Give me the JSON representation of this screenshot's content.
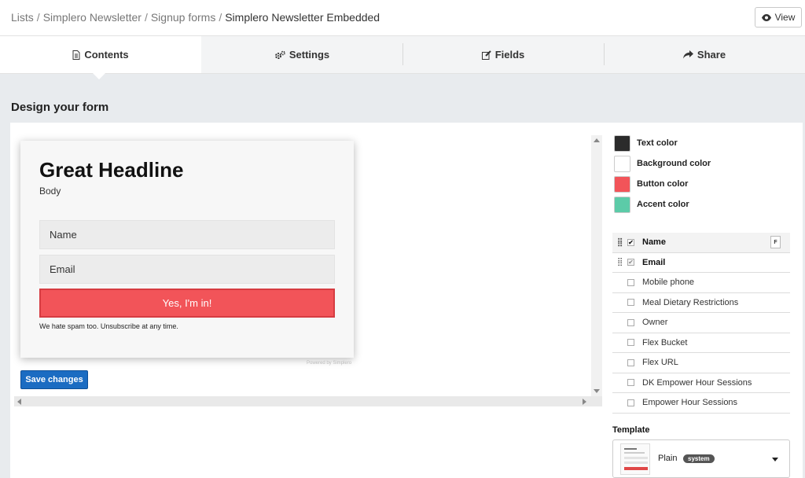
{
  "breadcrumb": {
    "items": [
      "Lists",
      "Simplero Newsletter",
      "Signup forms"
    ],
    "current": "Simplero Newsletter Embedded",
    "separator": "/"
  },
  "header": {
    "view_label": "View",
    "view_icon": "eye-icon"
  },
  "tabs": [
    {
      "label": "Contents",
      "icon": "document-icon",
      "active": true
    },
    {
      "label": "Settings",
      "icon": "gears-icon",
      "active": false
    },
    {
      "label": "Fields",
      "icon": "edit-icon",
      "active": false
    },
    {
      "label": "Share",
      "icon": "share-icon",
      "active": false
    }
  ],
  "section_title": "Design your form",
  "form_preview": {
    "headline": "Great Headline",
    "body": "Body",
    "name_placeholder": "Name",
    "email_placeholder": "Email",
    "button_label": "Yes, I'm in!",
    "disclaimer": "We hate spam too. Unsubscribe at any time.",
    "powered_by": "Powered by Simplero"
  },
  "save_label": "Save changes",
  "colors": [
    {
      "label": "Text color",
      "value": "#2b2b2b"
    },
    {
      "label": "Background color",
      "value": "#ffffff"
    },
    {
      "label": "Button color",
      "value": "#f25459"
    },
    {
      "label": "Accent color",
      "value": "#5ccba8"
    }
  ],
  "fields": [
    {
      "label": "Name",
      "checked": true,
      "locked": false,
      "draggable": true,
      "bold": true,
      "badge": "F"
    },
    {
      "label": "Email",
      "checked": true,
      "locked": true,
      "draggable": true,
      "bold": true
    },
    {
      "label": "Mobile phone",
      "checked": false
    },
    {
      "label": "Meal Dietary Restrictions",
      "checked": false
    },
    {
      "label": "Owner",
      "checked": false
    },
    {
      "label": "Flex Bucket",
      "checked": false
    },
    {
      "label": "Flex URL",
      "checked": false
    },
    {
      "label": "DK Empower Hour Sessions",
      "checked": false
    },
    {
      "label": "Empower Hour Sessions",
      "checked": false
    }
  ],
  "template": {
    "title": "Template",
    "name": "Plain",
    "badge": "system"
  }
}
